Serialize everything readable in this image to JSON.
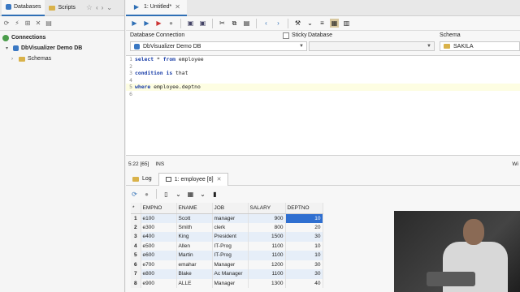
{
  "left_tabs": {
    "databases": "Databases",
    "scripts": "Scripts"
  },
  "tree": {
    "connections": "Connections",
    "db": "DbVisualizer Demo DB",
    "schemas": "Schemas"
  },
  "editor_tab": {
    "title": "1: Untitled*"
  },
  "connection": {
    "db_conn_label": "Database Connection",
    "db_conn_value": "DbVisualizer Demo DB",
    "sticky": "Sticky",
    "database_label": "Database",
    "schema_label": "Schema",
    "schema_value": "SAKILA"
  },
  "editor": {
    "lines": [
      {
        "n": "1",
        "kw1": "select",
        "rest1": " * ",
        "kw2": "from",
        "rest2": " employee"
      },
      {
        "n": "2"
      },
      {
        "n": "3",
        "kw1": "condition",
        "rest1": " ",
        "kw2": "is",
        "rest2": " that"
      },
      {
        "n": "4"
      },
      {
        "n": "5",
        "kw1": "where",
        "rest1": " employee.deptno"
      },
      {
        "n": "6"
      }
    ]
  },
  "status": {
    "pos": "5:22 [65]",
    "mode": "INS",
    "right": "Wi"
  },
  "result_tabs": {
    "log": "Log",
    "result": "1: employee [8]"
  },
  "table": {
    "headers": [
      "EMPNO",
      "ENAME",
      "JOB",
      "SALARY",
      "DEPTNO"
    ],
    "rows": [
      [
        "1",
        "e100",
        "Scott",
        "manager",
        "900",
        "10"
      ],
      [
        "2",
        "e300",
        "Smith",
        "clerk",
        "800",
        "20"
      ],
      [
        "3",
        "e400",
        "King",
        "President",
        "1500",
        "30"
      ],
      [
        "4",
        "e500",
        "Allen",
        "IT-Prog",
        "1100",
        "10"
      ],
      [
        "5",
        "e600",
        "Martin",
        "IT-Prog",
        "1100",
        "10"
      ],
      [
        "6",
        "e700",
        "emahar",
        "Manager",
        "1200",
        "30"
      ],
      [
        "7",
        "e800",
        "Blake",
        "Ac Manager",
        "1100",
        "30"
      ],
      [
        "8",
        "e900",
        "ALLE",
        "Manager",
        "1300",
        "40"
      ]
    ]
  },
  "colors": {
    "accent": "#2f6fb5",
    "selected_cell": "#2f6fd0"
  }
}
